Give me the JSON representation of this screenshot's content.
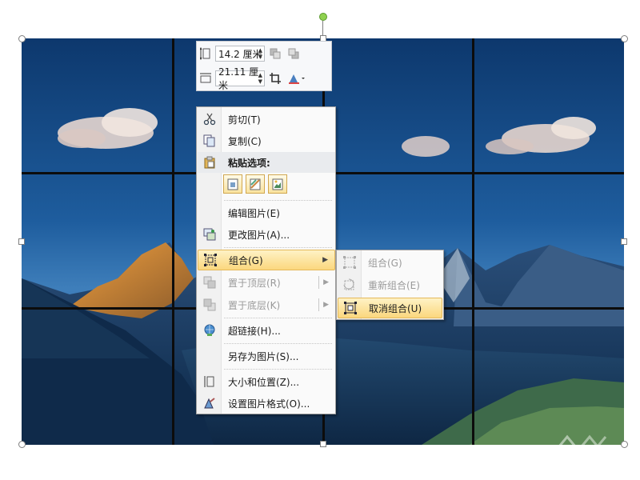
{
  "size_toolbar": {
    "height_value": "14.2 厘米",
    "width_value": "21.11 厘米"
  },
  "context_menu": {
    "items": [
      {
        "label": "剪切(T)",
        "icon": "scissors-icon"
      },
      {
        "label": "复制(C)",
        "icon": "copy-icon"
      },
      {
        "label": "粘贴选项:",
        "icon": "paste-icon"
      },
      {
        "label": "编辑图片(E)"
      },
      {
        "label": "更改图片(A)...",
        "icon": "change-picture-icon"
      },
      {
        "label": "组合(G)",
        "icon": "group-icon",
        "state": "active"
      },
      {
        "label": "置于顶层(R)",
        "icon": "bring-to-front-icon",
        "state": "disabled"
      },
      {
        "label": "置于底层(K)",
        "icon": "send-to-back-icon",
        "state": "disabled"
      },
      {
        "label": "超链接(H)...",
        "icon": "hyperlink-icon"
      },
      {
        "label": "另存为图片(S)..."
      },
      {
        "label": "大小和位置(Z)...",
        "icon": "size-position-icon"
      },
      {
        "label": "设置图片格式(O)...",
        "icon": "format-picture-icon"
      }
    ]
  },
  "submenu": {
    "items": [
      {
        "label": "组合(G)",
        "state": "disabled"
      },
      {
        "label": "重新组合(E)",
        "state": "disabled"
      },
      {
        "label": "取消组合(U)",
        "state": "active"
      }
    ]
  },
  "colors": {
    "menu_highlight": "#fbd77e",
    "menu_background": "#fafafa",
    "sky_top": "#0f3c73",
    "disabled_text": "#9a9a9a"
  }
}
